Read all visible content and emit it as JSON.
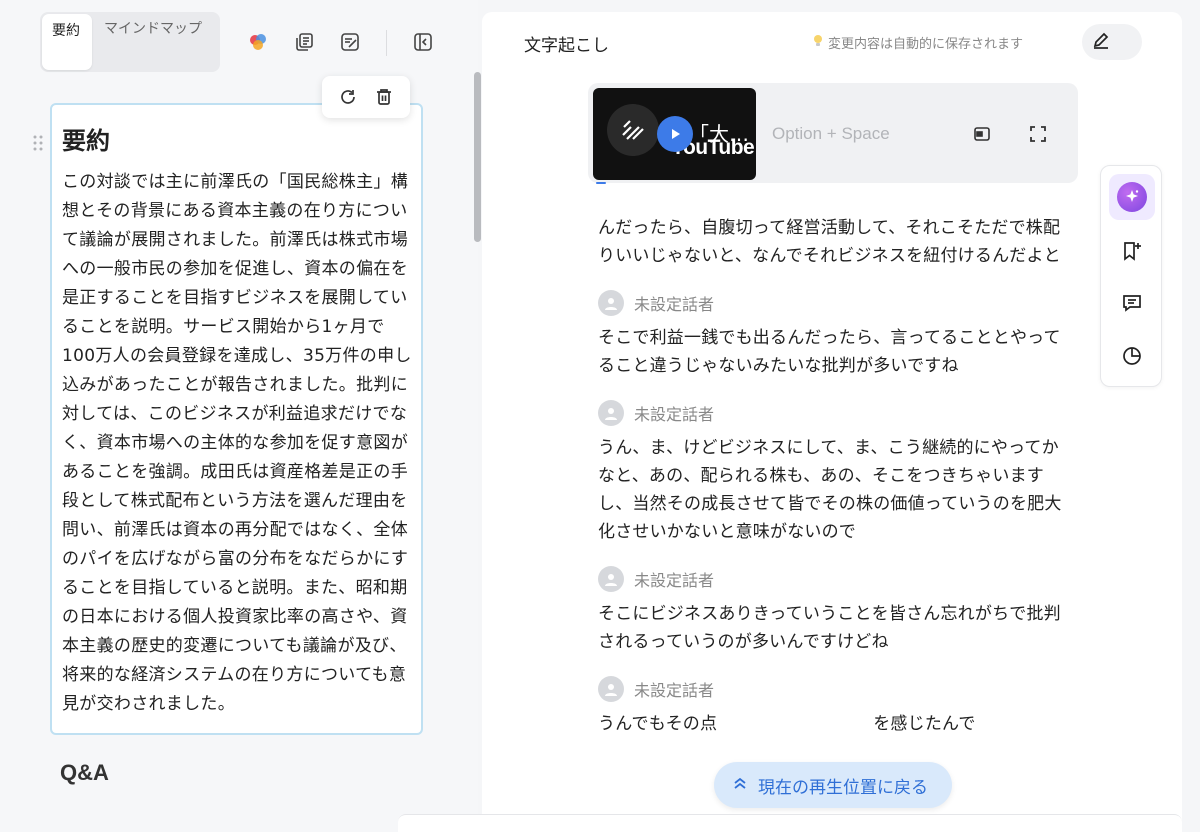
{
  "tabs": [
    {
      "label": "要約",
      "active": true
    },
    {
      "label": "マインドマップ",
      "active": false
    }
  ],
  "toolbar": {
    "icons": [
      "color-palette-icon",
      "copy-icon",
      "notes-edit-icon",
      "sidebar-collapse-icon"
    ]
  },
  "card_actions": {
    "icons": [
      "refresh-icon",
      "trash-icon"
    ]
  },
  "summary": {
    "title": "要約",
    "body": "この対談では主に前澤氏の「国民総株主」構想とその背景にある資本主義の在り方について議論が展開されました。前澤氏は株式市場への一般市民の参加を促進し、資本の偏在を是正することを目指すビジネスを展開していることを説明。サービス開始から1ヶ月で100万人の会員登録を達成し、35万件の申し込みがあったことが報告されました。批判に対しては、このビジネスが利益追求だけでなく、資本市場への主体的な参加を促す意図があることを強調。成田氏は資産格差是正の手段として株式配布という方法を選んだ理由を問い、前澤氏は資本の再分配ではなく、全体のパイを広げながら富の分布をなだらかにすることを目指していると説明。また、昭和期の日本における個人投資家比率の高さや、資本主義の歴史的変遷についても議論が及び、将来的な経済システムの在り方についても意見が交わされました。"
  },
  "qa_heading": "Q&A",
  "right": {
    "title": "文字起こし",
    "autosave": "変更内容は自動的に保存されます"
  },
  "video": {
    "thumb_text": "「大…",
    "thumb_brand": "YouTube",
    "shortcut": "Option + Space"
  },
  "transcript": [
    {
      "speaker": "",
      "text": "んだったら、自腹切って経営活動して、それこそただで株配りいいじゃないと、なんでそれビジネスを紐付けるんだよと"
    },
    {
      "speaker": "未設定話者",
      "text": "そこで利益一銭でも出るんだったら、言ってることとやってること違うじゃないみたいな批判が多いですね"
    },
    {
      "speaker": "未設定話者",
      "text": "うん、ま、けどビジネスにして、ま、こう継続的にやってかなと、あの、配られる株も、あの、そこをつきちゃいますし、当然その成長させて皆でその株の価値っていうのを肥大化させいかないと意味がないので"
    },
    {
      "speaker": "未設定話者",
      "text": "そこにビジネスありきっていうことを皆さん忘れがちで批判されるっていうのが多いんですけどね"
    },
    {
      "speaker": "未設定話者",
      "text": "うんでもその点"
    }
  ],
  "return_button": "現在の再生位置に戻る",
  "transcript_tail": "を感じたんで",
  "side_tools": [
    "ai-sparkle-icon",
    "bookmark-add-icon",
    "comment-icon",
    "pie-chart-icon"
  ],
  "colors": {
    "accent": "#3d7be8",
    "card_border": "#bfe0f2",
    "pill_bg": "#d9e9fb"
  }
}
